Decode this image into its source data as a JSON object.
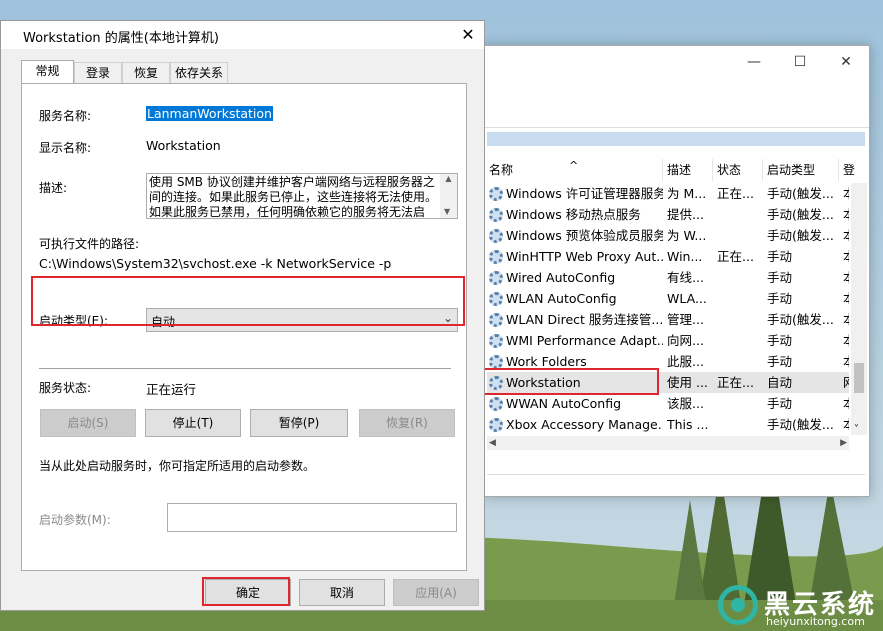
{
  "dialog": {
    "title": "Workstation 的属性(本地计算机)",
    "close_glyph": "✕",
    "tabs": [
      "常规",
      "登录",
      "恢复",
      "依存关系"
    ],
    "service_name_label": "服务名称:",
    "service_name": "LanmanWorkstation",
    "display_name_label": "显示名称:",
    "display_name": "Workstation",
    "description_label": "描述:",
    "description": "使用 SMB 协议创建并维护客户端网络与远程服务器之间的连接。如果此服务已停止，这些连接将无法使用。如果此服务已禁用，任何明确依赖它的服务将无法启动。",
    "exe_path_label": "可执行文件的路径:",
    "exe_path": "C:\\Windows\\System32\\svchost.exe -k NetworkService -p",
    "startup_type_label": "启动类型(E):",
    "startup_type_value": "自动",
    "service_status_label": "服务状态:",
    "service_status": "正在运行",
    "buttons": {
      "start": "启动(S)",
      "stop": "停止(T)",
      "pause": "暂停(P)",
      "resume": "恢复(R)"
    },
    "hint": "当从此处启动服务时，你可指定所适用的启动参数。",
    "start_params_label": "启动参数(M):",
    "start_params_value": "",
    "ok": "确定",
    "cancel": "取消",
    "apply": "应用(A)"
  },
  "services_window": {
    "minimize_glyph": "—",
    "maximize_glyph": "☐",
    "close_glyph": "✕",
    "columns": [
      "名称",
      "描述",
      "状态",
      "启动类型",
      "登"
    ],
    "sort_glyph": "^",
    "rows": [
      {
        "name": "Windows 许可证管理器服务",
        "desc": "为 M...",
        "status": "正在...",
        "startup": "手动(触发...",
        "logon": "本"
      },
      {
        "name": "Windows 移动热点服务",
        "desc": "提供...",
        "status": "",
        "startup": "手动(触发...",
        "logon": "本"
      },
      {
        "name": "Windows 预览体验成员服务",
        "desc": "为 W...",
        "status": "",
        "startup": "手动(触发...",
        "logon": "本"
      },
      {
        "name": "WinHTTP Web Proxy Aut...",
        "desc": "Win...",
        "status": "正在...",
        "startup": "手动",
        "logon": "本"
      },
      {
        "name": "Wired AutoConfig",
        "desc": "有线...",
        "status": "",
        "startup": "手动",
        "logon": "本"
      },
      {
        "name": "WLAN AutoConfig",
        "desc": "WLA...",
        "status": "",
        "startup": "手动",
        "logon": "本"
      },
      {
        "name": "WLAN Direct 服务连接管...",
        "desc": "管理...",
        "status": "",
        "startup": "手动(触发...",
        "logon": "本"
      },
      {
        "name": "WMI Performance Adapt...",
        "desc": "向网...",
        "status": "",
        "startup": "手动",
        "logon": "本"
      },
      {
        "name": "Work Folders",
        "desc": "此服...",
        "status": "",
        "startup": "手动",
        "logon": "本"
      },
      {
        "name": "Workstation",
        "desc": "使用 ...",
        "status": "正在...",
        "startup": "自动",
        "logon": "网"
      },
      {
        "name": "WWAN AutoConfig",
        "desc": "该服...",
        "status": "",
        "startup": "手动",
        "logon": "本"
      },
      {
        "name": "Xbox Accessory Manage...",
        "desc": "This ...",
        "status": "",
        "startup": "手动(触发...",
        "logon": "本"
      }
    ],
    "selected_row": "Workstation"
  },
  "watermark": {
    "cn": "黑云系统",
    "en": "heiyunxitong.com"
  },
  "colors": {
    "selection_blue": "#0078d7",
    "highlight_red": "#e0262f",
    "watermark_teal": "#2fb5a3"
  }
}
